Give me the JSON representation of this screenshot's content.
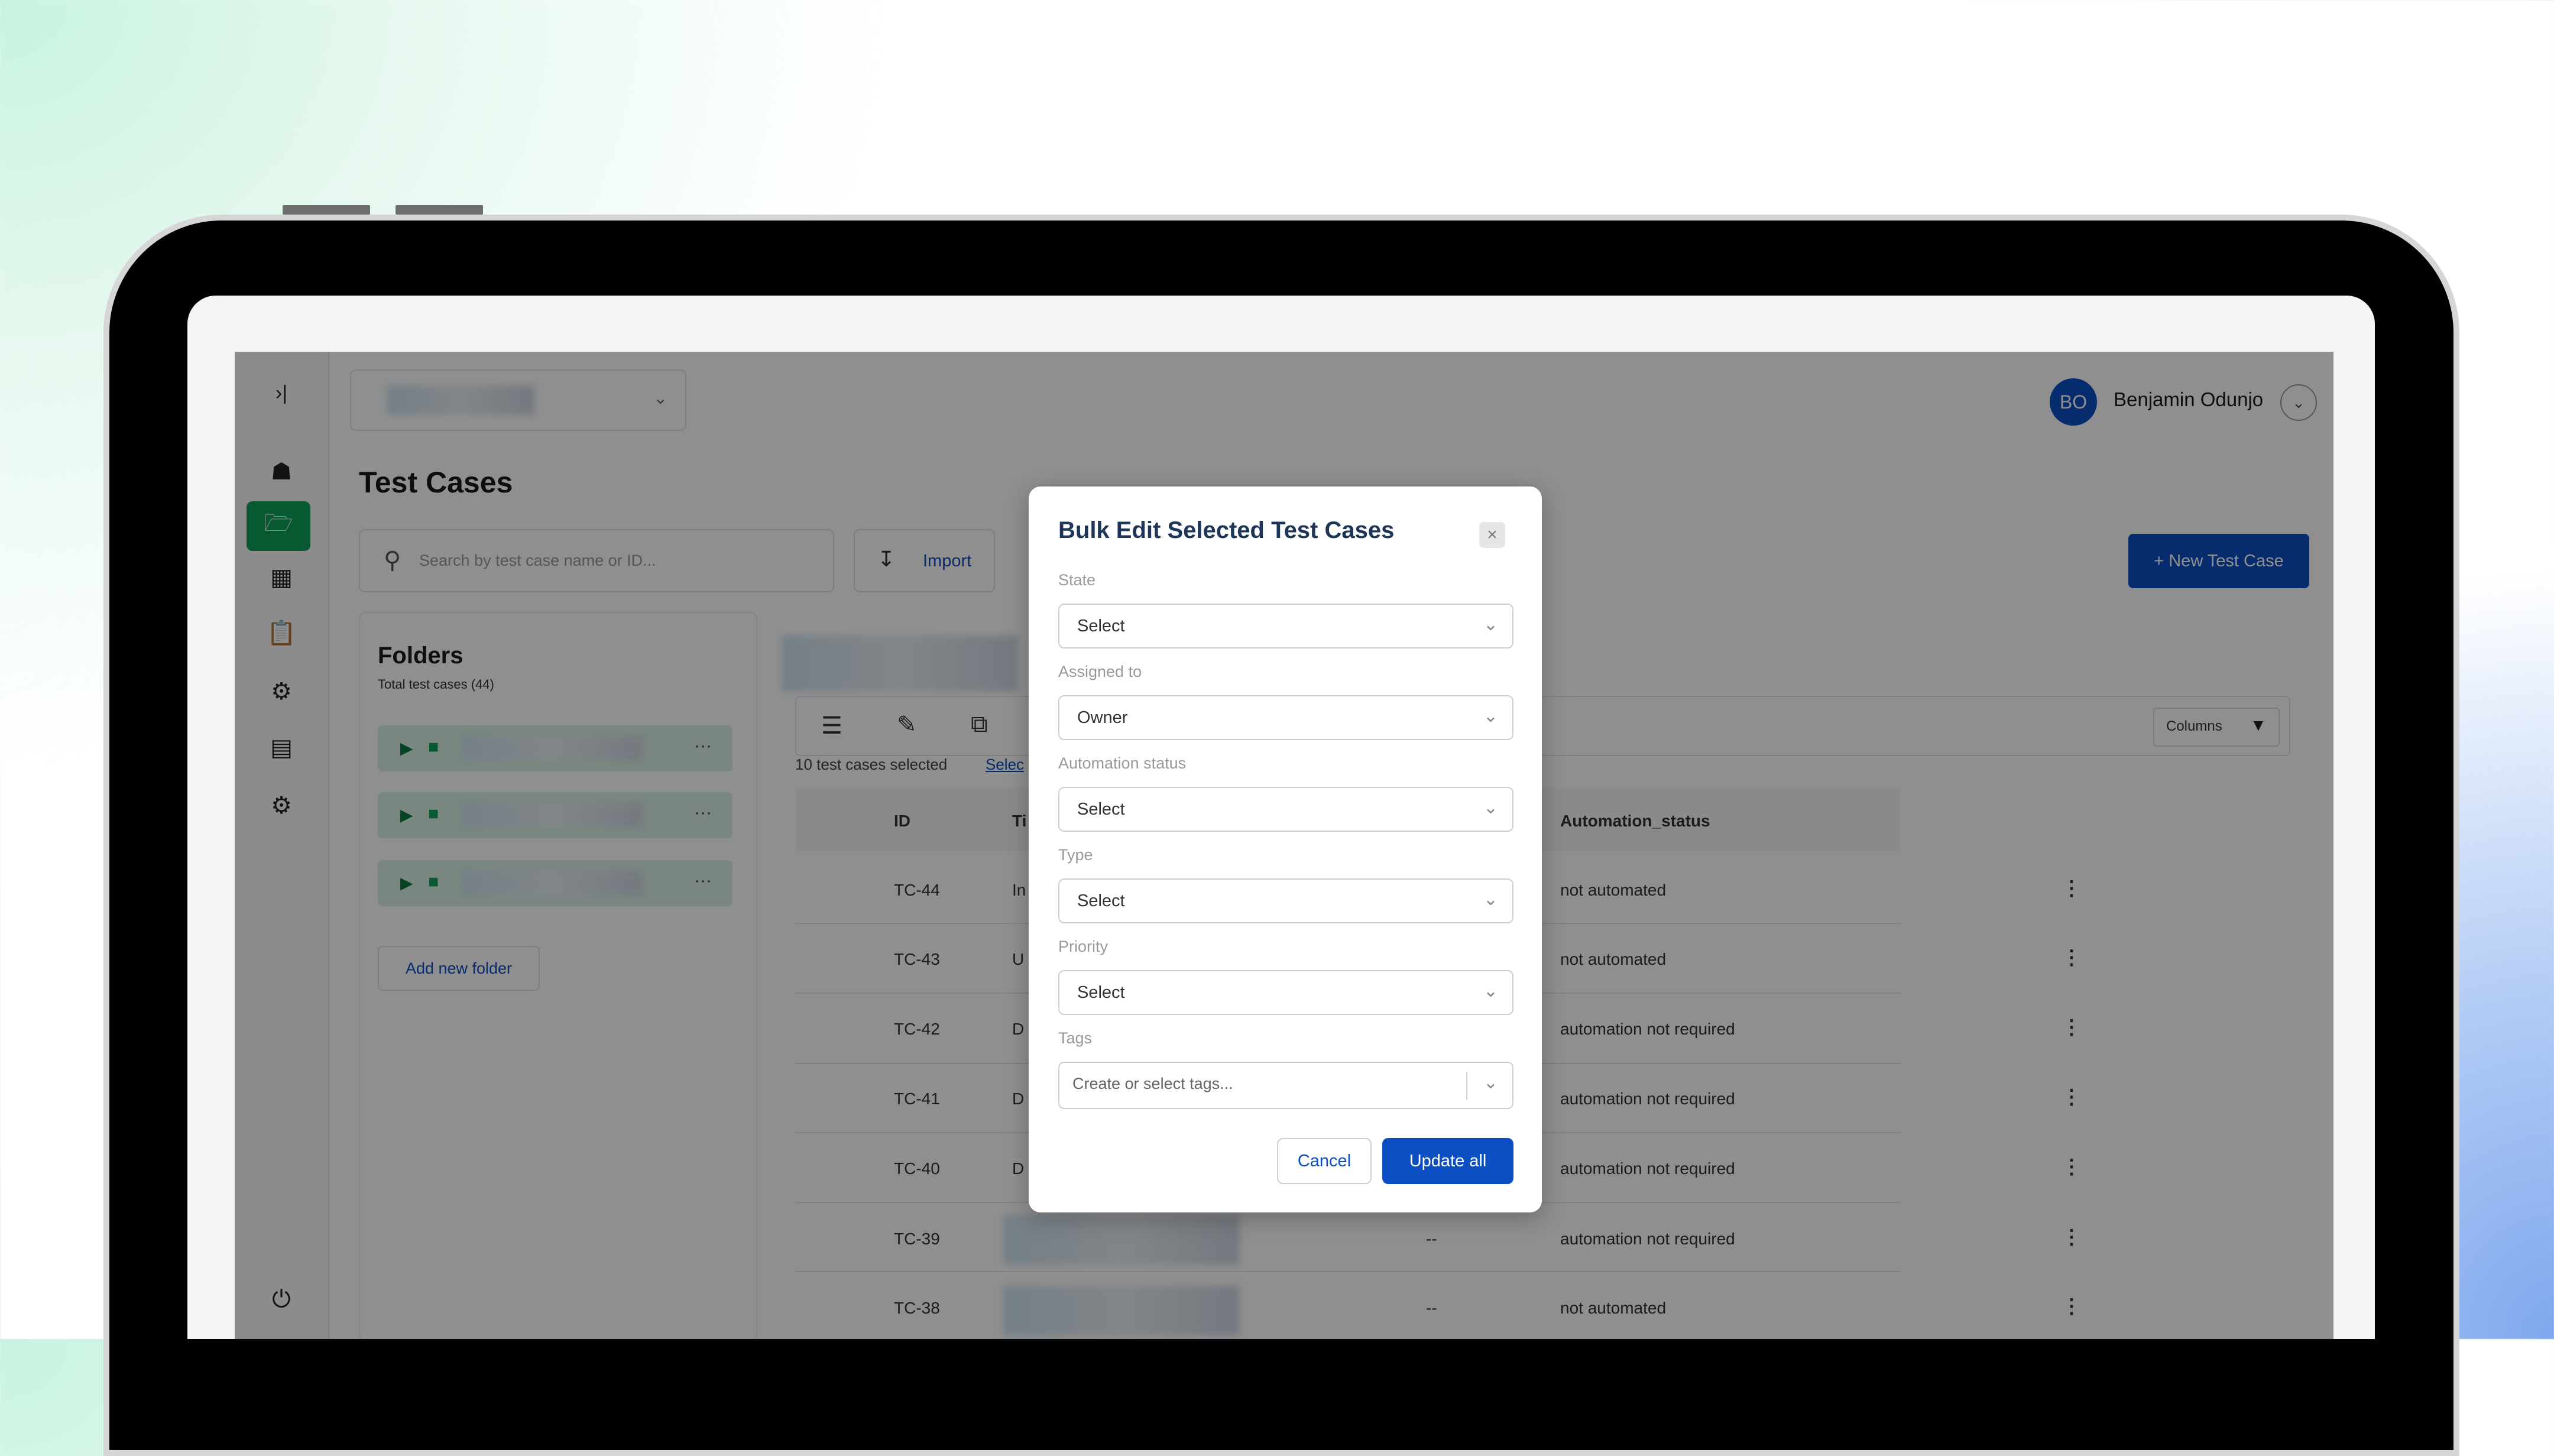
{
  "user": {
    "initials": "BO",
    "name": "Benjamin Odunjo"
  },
  "page": {
    "title": "Test Cases"
  },
  "search": {
    "placeholder": "Search by test case name or ID..."
  },
  "toolbar": {
    "import_label": "Import",
    "new_test_case_label": "+ New Test Case",
    "columns_label": "Columns"
  },
  "folders": {
    "title": "Folders",
    "subtitle": "Total test cases (44)",
    "add_label": "Add new folder",
    "item_menu": "···"
  },
  "selection": {
    "text": "10 test cases selected",
    "link": "Selec"
  },
  "table": {
    "headers": {
      "id": "ID",
      "title_partial": "Ti",
      "automation_status": "Automation_status"
    },
    "rows": [
      {
        "id": "TC-44",
        "title": "In",
        "dash": "",
        "automation": "not automated"
      },
      {
        "id": "TC-43",
        "title": "U",
        "dash": "",
        "automation": "not automated"
      },
      {
        "id": "TC-42",
        "title": "D",
        "dash": "",
        "automation": "automation not required"
      },
      {
        "id": "TC-41",
        "title": "D",
        "dash": "",
        "automation": "automation not required"
      },
      {
        "id": "TC-40",
        "title": "D",
        "dash": "",
        "automation": "automation not required"
      },
      {
        "id": "TC-39",
        "title": "",
        "dash": "--",
        "automation": "automation not required"
      },
      {
        "id": "TC-38",
        "title": "",
        "dash": "--",
        "automation": "not automated"
      }
    ]
  },
  "modal": {
    "title": "Bulk Edit Selected Test Cases",
    "close": "×",
    "fields": [
      {
        "label": "State",
        "value": "Select"
      },
      {
        "label": "Assigned to",
        "value": "Owner"
      },
      {
        "label": "Automation status",
        "value": "Select"
      },
      {
        "label": "Type",
        "value": "Select"
      },
      {
        "label": "Priority",
        "value": "Select"
      }
    ],
    "tags": {
      "label": "Tags",
      "placeholder": "Create or select tags..."
    },
    "cancel_label": "Cancel",
    "update_label": "Update all"
  },
  "colors": {
    "primary": "#0b4fc2",
    "accent_green": "#0f9d58"
  }
}
